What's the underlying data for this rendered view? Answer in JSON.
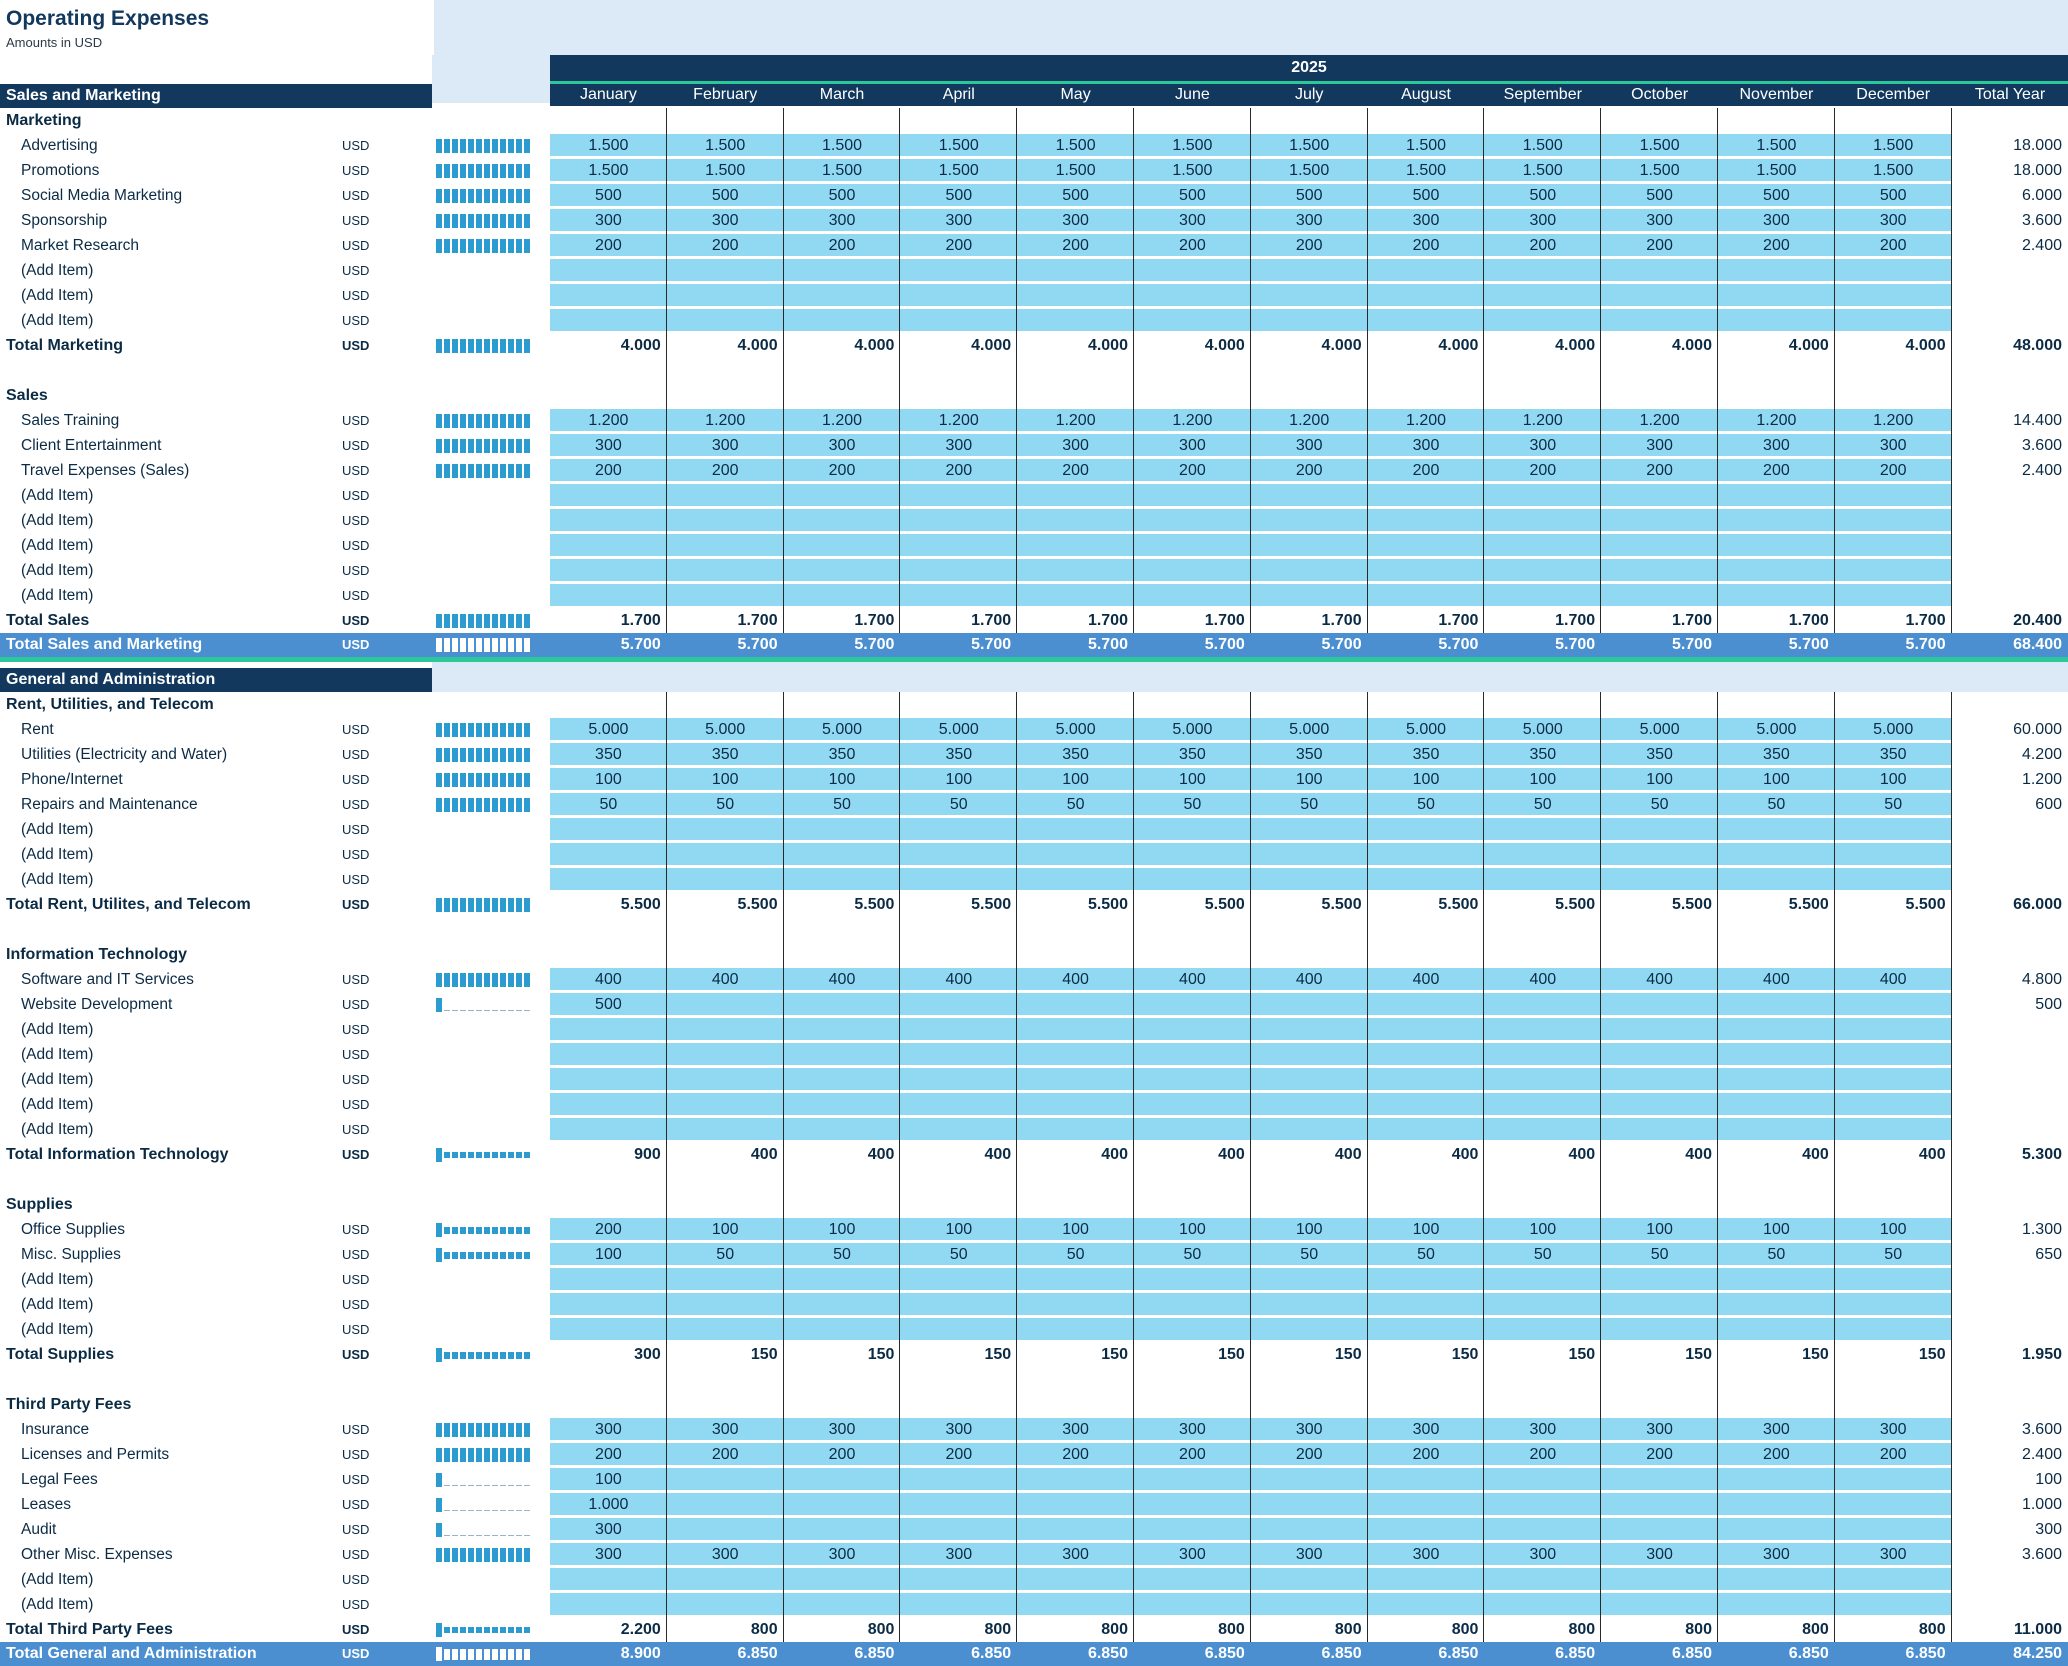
{
  "title": "Operating Expenses",
  "subtitle": "Amounts in USD",
  "year": "2025",
  "months": [
    "January",
    "February",
    "March",
    "April",
    "May",
    "June",
    "July",
    "August",
    "September",
    "October",
    "November",
    "December"
  ],
  "total_year_label": "Total Year",
  "currency": "USD",
  "colors": {
    "navy": "#12385e",
    "light_blue": "#91d9f3",
    "pale_bg": "#dce9f7",
    "accent_green": "#2cc79a",
    "total_band": "#4b8fd1",
    "spark": "#2b9bd0"
  },
  "sections": [
    {
      "header": "Sales and Marketing",
      "total_label": "Total Sales and Marketing",
      "total_values": [
        "5.700",
        "5.700",
        "5.700",
        "5.700",
        "5.700",
        "5.700",
        "5.700",
        "5.700",
        "5.700",
        "5.700",
        "5.700",
        "5.700"
      ],
      "total_year": "68.400",
      "groups": [
        {
          "title": "Marketing",
          "items": [
            {
              "name": "Advertising",
              "values": [
                "1.500",
                "1.500",
                "1.500",
                "1.500",
                "1.500",
                "1.500",
                "1.500",
                "1.500",
                "1.500",
                "1.500",
                "1.500",
                "1.500"
              ],
              "total": "18.000"
            },
            {
              "name": "Promotions",
              "values": [
                "1.500",
                "1.500",
                "1.500",
                "1.500",
                "1.500",
                "1.500",
                "1.500",
                "1.500",
                "1.500",
                "1.500",
                "1.500",
                "1.500"
              ],
              "total": "18.000"
            },
            {
              "name": "Social Media Marketing",
              "values": [
                "500",
                "500",
                "500",
                "500",
                "500",
                "500",
                "500",
                "500",
                "500",
                "500",
                "500",
                "500"
              ],
              "total": "6.000"
            },
            {
              "name": "Sponsorship",
              "values": [
                "300",
                "300",
                "300",
                "300",
                "300",
                "300",
                "300",
                "300",
                "300",
                "300",
                "300",
                "300"
              ],
              "total": "3.600"
            },
            {
              "name": "Market Research",
              "values": [
                "200",
                "200",
                "200",
                "200",
                "200",
                "200",
                "200",
                "200",
                "200",
                "200",
                "200",
                "200"
              ],
              "total": "2.400"
            },
            {
              "name": "(Add Item)",
              "values": [],
              "total": ""
            },
            {
              "name": "(Add Item)",
              "values": [],
              "total": ""
            },
            {
              "name": "(Add Item)",
              "values": [],
              "total": ""
            }
          ],
          "total_label": "Total Marketing",
          "total_values": [
            "4.000",
            "4.000",
            "4.000",
            "4.000",
            "4.000",
            "4.000",
            "4.000",
            "4.000",
            "4.000",
            "4.000",
            "4.000",
            "4.000"
          ],
          "total_year": "48.000"
        },
        {
          "title": "Sales",
          "items": [
            {
              "name": "Sales Training",
              "values": [
                "1.200",
                "1.200",
                "1.200",
                "1.200",
                "1.200",
                "1.200",
                "1.200",
                "1.200",
                "1.200",
                "1.200",
                "1.200",
                "1.200"
              ],
              "total": "14.400"
            },
            {
              "name": "Client Entertainment",
              "values": [
                "300",
                "300",
                "300",
                "300",
                "300",
                "300",
                "300",
                "300",
                "300",
                "300",
                "300",
                "300"
              ],
              "total": "3.600"
            },
            {
              "name": "Travel Expenses (Sales)",
              "values": [
                "200",
                "200",
                "200",
                "200",
                "200",
                "200",
                "200",
                "200",
                "200",
                "200",
                "200",
                "200"
              ],
              "total": "2.400"
            },
            {
              "name": "(Add Item)",
              "values": [],
              "total": ""
            },
            {
              "name": "(Add Item)",
              "values": [],
              "total": ""
            },
            {
              "name": "(Add Item)",
              "values": [],
              "total": ""
            },
            {
              "name": "(Add Item)",
              "values": [],
              "total": ""
            },
            {
              "name": "(Add Item)",
              "values": [],
              "total": ""
            }
          ],
          "total_label": "Total Sales",
          "total_values": [
            "1.700",
            "1.700",
            "1.700",
            "1.700",
            "1.700",
            "1.700",
            "1.700",
            "1.700",
            "1.700",
            "1.700",
            "1.700",
            "1.700"
          ],
          "total_year": "20.400"
        }
      ]
    },
    {
      "header": "General and Administration",
      "total_label": "Total General and Administration",
      "total_values": [
        "8.900",
        "6.850",
        "6.850",
        "6.850",
        "6.850",
        "6.850",
        "6.850",
        "6.850",
        "6.850",
        "6.850",
        "6.850",
        "6.850"
      ],
      "total_year": "84.250",
      "groups": [
        {
          "title": "Rent, Utilities, and Telecom",
          "items": [
            {
              "name": "Rent",
              "values": [
                "5.000",
                "5.000",
                "5.000",
                "5.000",
                "5.000",
                "5.000",
                "5.000",
                "5.000",
                "5.000",
                "5.000",
                "5.000",
                "5.000"
              ],
              "total": "60.000"
            },
            {
              "name": "Utilities (Electricity and Water)",
              "values": [
                "350",
                "350",
                "350",
                "350",
                "350",
                "350",
                "350",
                "350",
                "350",
                "350",
                "350",
                "350"
              ],
              "total": "4.200"
            },
            {
              "name": "Phone/Internet",
              "values": [
                "100",
                "100",
                "100",
                "100",
                "100",
                "100",
                "100",
                "100",
                "100",
                "100",
                "100",
                "100"
              ],
              "total": "1.200"
            },
            {
              "name": "Repairs and Maintenance",
              "values": [
                "50",
                "50",
                "50",
                "50",
                "50",
                "50",
                "50",
                "50",
                "50",
                "50",
                "50",
                "50"
              ],
              "total": "600"
            },
            {
              "name": "(Add Item)",
              "values": [],
              "total": ""
            },
            {
              "name": "(Add Item)",
              "values": [],
              "total": ""
            },
            {
              "name": "(Add Item)",
              "values": [],
              "total": ""
            }
          ],
          "total_label": "Total Rent, Utilites, and Telecom",
          "total_values": [
            "5.500",
            "5.500",
            "5.500",
            "5.500",
            "5.500",
            "5.500",
            "5.500",
            "5.500",
            "5.500",
            "5.500",
            "5.500",
            "5.500"
          ],
          "total_year": "66.000"
        },
        {
          "title": "Information Technology",
          "items": [
            {
              "name": "Software and IT Services",
              "values": [
                "400",
                "400",
                "400",
                "400",
                "400",
                "400",
                "400",
                "400",
                "400",
                "400",
                "400",
                "400"
              ],
              "total": "4.800"
            },
            {
              "name": "Website Development",
              "values": [
                "500",
                "",
                "",
                "",
                "",
                "",
                "",
                "",
                "",
                "",
                "",
                ""
              ],
              "total": "500"
            },
            {
              "name": "(Add Item)",
              "values": [],
              "total": ""
            },
            {
              "name": "(Add Item)",
              "values": [],
              "total": ""
            },
            {
              "name": "(Add Item)",
              "values": [],
              "total": ""
            },
            {
              "name": "(Add Item)",
              "values": [],
              "total": ""
            },
            {
              "name": "(Add Item)",
              "values": [],
              "total": ""
            }
          ],
          "total_label": "Total Information Technology",
          "total_values": [
            "900",
            "400",
            "400",
            "400",
            "400",
            "400",
            "400",
            "400",
            "400",
            "400",
            "400",
            "400"
          ],
          "total_year": "5.300"
        },
        {
          "title": "Supplies",
          "items": [
            {
              "name": "Office Supplies",
              "values": [
                "200",
                "100",
                "100",
                "100",
                "100",
                "100",
                "100",
                "100",
                "100",
                "100",
                "100",
                "100"
              ],
              "total": "1.300"
            },
            {
              "name": "Misc. Supplies",
              "values": [
                "100",
                "50",
                "50",
                "50",
                "50",
                "50",
                "50",
                "50",
                "50",
                "50",
                "50",
                "50"
              ],
              "total": "650"
            },
            {
              "name": "(Add Item)",
              "values": [],
              "total": ""
            },
            {
              "name": "(Add Item)",
              "values": [],
              "total": ""
            },
            {
              "name": "(Add Item)",
              "values": [],
              "total": ""
            }
          ],
          "total_label": "Total Supplies",
          "total_values": [
            "300",
            "150",
            "150",
            "150",
            "150",
            "150",
            "150",
            "150",
            "150",
            "150",
            "150",
            "150"
          ],
          "total_year": "1.950"
        },
        {
          "title": "Third Party Fees",
          "items": [
            {
              "name": "Insurance",
              "values": [
                "300",
                "300",
                "300",
                "300",
                "300",
                "300",
                "300",
                "300",
                "300",
                "300",
                "300",
                "300"
              ],
              "total": "3.600"
            },
            {
              "name": "Licenses and Permits",
              "values": [
                "200",
                "200",
                "200",
                "200",
                "200",
                "200",
                "200",
                "200",
                "200",
                "200",
                "200",
                "200"
              ],
              "total": "2.400"
            },
            {
              "name": "Legal Fees",
              "values": [
                "100",
                "",
                "",
                "",
                "",
                "",
                "",
                "",
                "",
                "",
                "",
                ""
              ],
              "total": "100"
            },
            {
              "name": "Leases",
              "values": [
                "1.000",
                "",
                "",
                "",
                "",
                "",
                "",
                "",
                "",
                "",
                "",
                ""
              ],
              "total": "1.000"
            },
            {
              "name": "Audit",
              "values": [
                "300",
                "",
                "",
                "",
                "",
                "",
                "",
                "",
                "",
                "",
                "",
                ""
              ],
              "total": "300"
            },
            {
              "name": "Other Misc. Expenses",
              "values": [
                "300",
                "300",
                "300",
                "300",
                "300",
                "300",
                "300",
                "300",
                "300",
                "300",
                "300",
                "300"
              ],
              "total": "3.600"
            },
            {
              "name": "(Add Item)",
              "values": [],
              "total": ""
            },
            {
              "name": "(Add Item)",
              "values": [],
              "total": ""
            }
          ],
          "total_label": "Total Third Party Fees",
          "total_values": [
            "2.200",
            "800",
            "800",
            "800",
            "800",
            "800",
            "800",
            "800",
            "800",
            "800",
            "800",
            "800"
          ],
          "total_year": "11.000"
        }
      ]
    }
  ]
}
